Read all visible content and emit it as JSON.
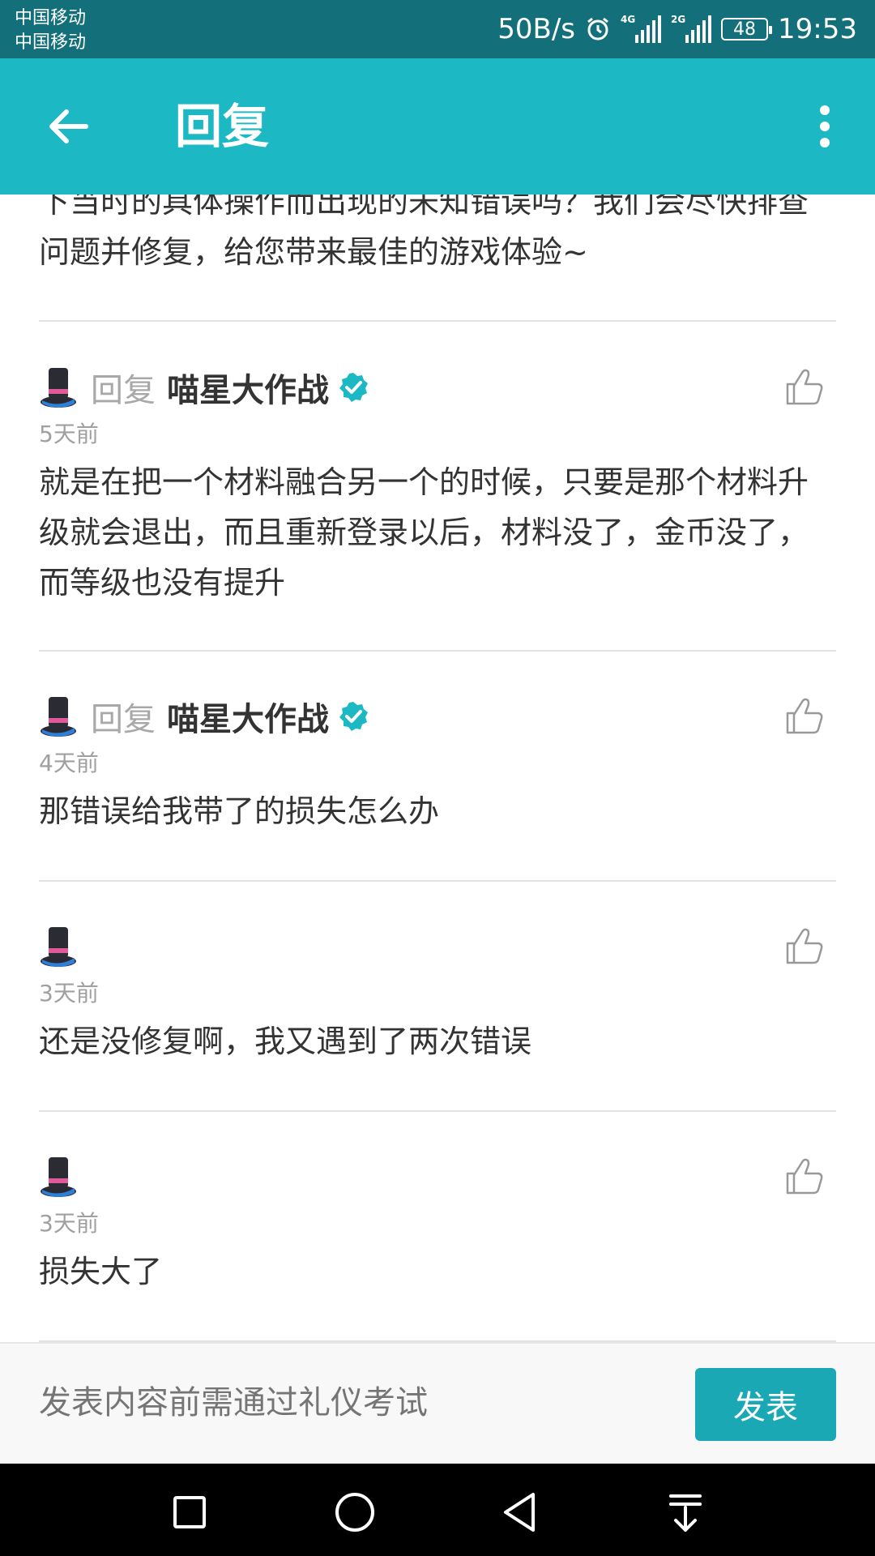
{
  "status_bar": {
    "carrier_1": "中国移动",
    "carrier_2": "中国移动",
    "speed": "50B/s",
    "net_1": "4G",
    "net_2": "2G",
    "battery": "48",
    "time": "19:53"
  },
  "app_bar": {
    "title": "回复",
    "back_icon": "arrow-left-icon",
    "more_icon": "more-vertical-icon"
  },
  "thread": {
    "previous_text": "下当时的具体操作而出现的未知错误吗？我们会尽快排查问题并修复，给您带来最佳的游戏体验~",
    "replies": [
      {
        "reply_label": "回复",
        "reply_to": "喵星大作战",
        "verified": true,
        "time": "5天前",
        "text": "就是在把一个材料融合另一个的时候，只要是那个材料升级就会退出，而且重新登录以后，材料没了，金币没了，而等级也没有提升"
      },
      {
        "reply_label": "回复",
        "reply_to": "喵星大作战",
        "verified": true,
        "time": "4天前",
        "text": "那错误给我带了的损失怎么办"
      },
      {
        "reply_label": "",
        "reply_to": "",
        "verified": false,
        "time": "3天前",
        "text": "还是没修复啊，我又遇到了两次错误"
      },
      {
        "reply_label": "",
        "reply_to": "",
        "verified": false,
        "time": "3天前",
        "text": "损失大了"
      }
    ]
  },
  "composer": {
    "placeholder": "发表内容前需通过礼仪考试",
    "submit_label": "发表"
  },
  "colors": {
    "status_bar": "#13707a",
    "app_bar": "#1cb8c4",
    "button": "#1aa8b4",
    "verified": "#1cb8c4"
  }
}
